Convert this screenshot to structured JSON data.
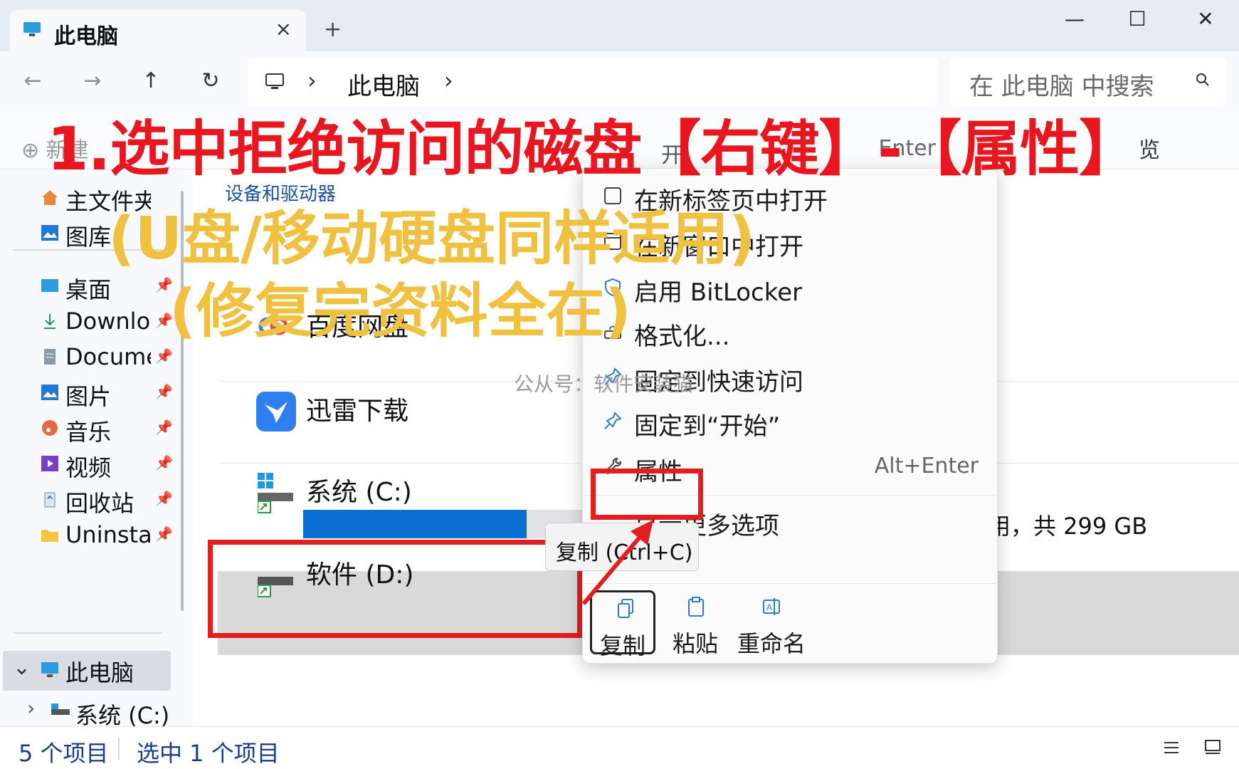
{
  "window": {
    "tab_title": "此电脑",
    "tab_close": "×",
    "new_tab": "+",
    "minimize": "—",
    "maximize": "☐",
    "close": "✕"
  },
  "nav": {
    "back": "←",
    "forward": "→",
    "up": "↑",
    "refresh": "↻",
    "breadcrumb_sep": "›",
    "breadcrumb": "此电脑",
    "search_placeholder": "在 此电脑 中搜索"
  },
  "toolbar": {
    "new_label": "⊕ 新建",
    "preview_label": "览"
  },
  "sidebar": {
    "items": [
      {
        "label": "主文件夹",
        "icon": "home-icon",
        "pinned": false
      },
      {
        "label": "图库",
        "icon": "gallery-icon",
        "pinned": false
      },
      {
        "label": "桌面",
        "icon": "desktop-icon",
        "pinned": true
      },
      {
        "label": "Downloads",
        "icon": "download-icon",
        "pinned": true
      },
      {
        "label": "Documents",
        "icon": "document-icon",
        "pinned": true
      },
      {
        "label": "图片",
        "icon": "pictures-icon",
        "pinned": true
      },
      {
        "label": "音乐",
        "icon": "music-icon",
        "pinned": true
      },
      {
        "label": "视频",
        "icon": "video-icon",
        "pinned": true
      },
      {
        "label": "回收站",
        "icon": "recycle-bin-icon",
        "pinned": true
      },
      {
        "label": "Uninstall",
        "icon": "folder-icon",
        "pinned": true
      }
    ],
    "this_pc": "此电脑",
    "system_c": "系统 (C:)",
    "expand_down": "⌄",
    "expand_right": "›"
  },
  "main": {
    "group_header": "设备和驱动器",
    "items": [
      {
        "name": "百度网盘",
        "icon": "baidu-netdisk-icon"
      },
      {
        "name": "迅雷下载",
        "icon": "xunlei-icon"
      },
      {
        "name": "系统 (C:)",
        "icon": "drive-icon",
        "used_fraction": 0.56
      },
      {
        "name": "软件 (D:)",
        "icon": "drive-icon"
      }
    ],
    "c_capacity": "用，共 299 GB"
  },
  "context_menu": {
    "items": [
      {
        "label": "在新标签页中打开",
        "icon": "new-tab-icon",
        "shortcut": ""
      },
      {
        "label": "在新窗口中打开",
        "icon": "new-window-icon",
        "shortcut": ""
      },
      {
        "label": "启用 BitLocker",
        "icon": "shield-icon",
        "shortcut": ""
      },
      {
        "label": "格式化...",
        "icon": "format-icon",
        "shortcut": ""
      },
      {
        "label": "固定到快速访问",
        "icon": "pin-icon",
        "shortcut": ""
      },
      {
        "label": "固定到“开始”",
        "icon": "pin-icon",
        "shortcut": ""
      },
      {
        "label": "属性",
        "icon": "wrench-icon",
        "shortcut": "Alt+Enter"
      },
      {
        "label": "显示更多选项",
        "icon": "more-options-icon",
        "shortcut": ""
      }
    ],
    "top_partial": "开",
    "top_shortcut": "Enter",
    "actions": [
      {
        "label": "复制",
        "icon": "copy-icon"
      },
      {
        "label": "粘贴",
        "icon": "paste-icon"
      },
      {
        "label": "重命名",
        "icon": "rename-icon"
      }
    ],
    "tooltip": "复制 (Ctrl+C)"
  },
  "status": {
    "count": "5 个项目",
    "selected": "选中 1 个项目"
  },
  "overlay": {
    "title": "1.选中拒绝访问的磁盘【右键】-【属性】",
    "subtitle1": "(U盘/移动硬盘同样适用)",
    "subtitle2": "(修复完资料全在)",
    "watermark": "公从号：软件安装猫"
  },
  "colors": {
    "accent": "#0b6fd1",
    "highlight_red": "#e21e1e",
    "overlay_yellow": "#f0c140"
  }
}
